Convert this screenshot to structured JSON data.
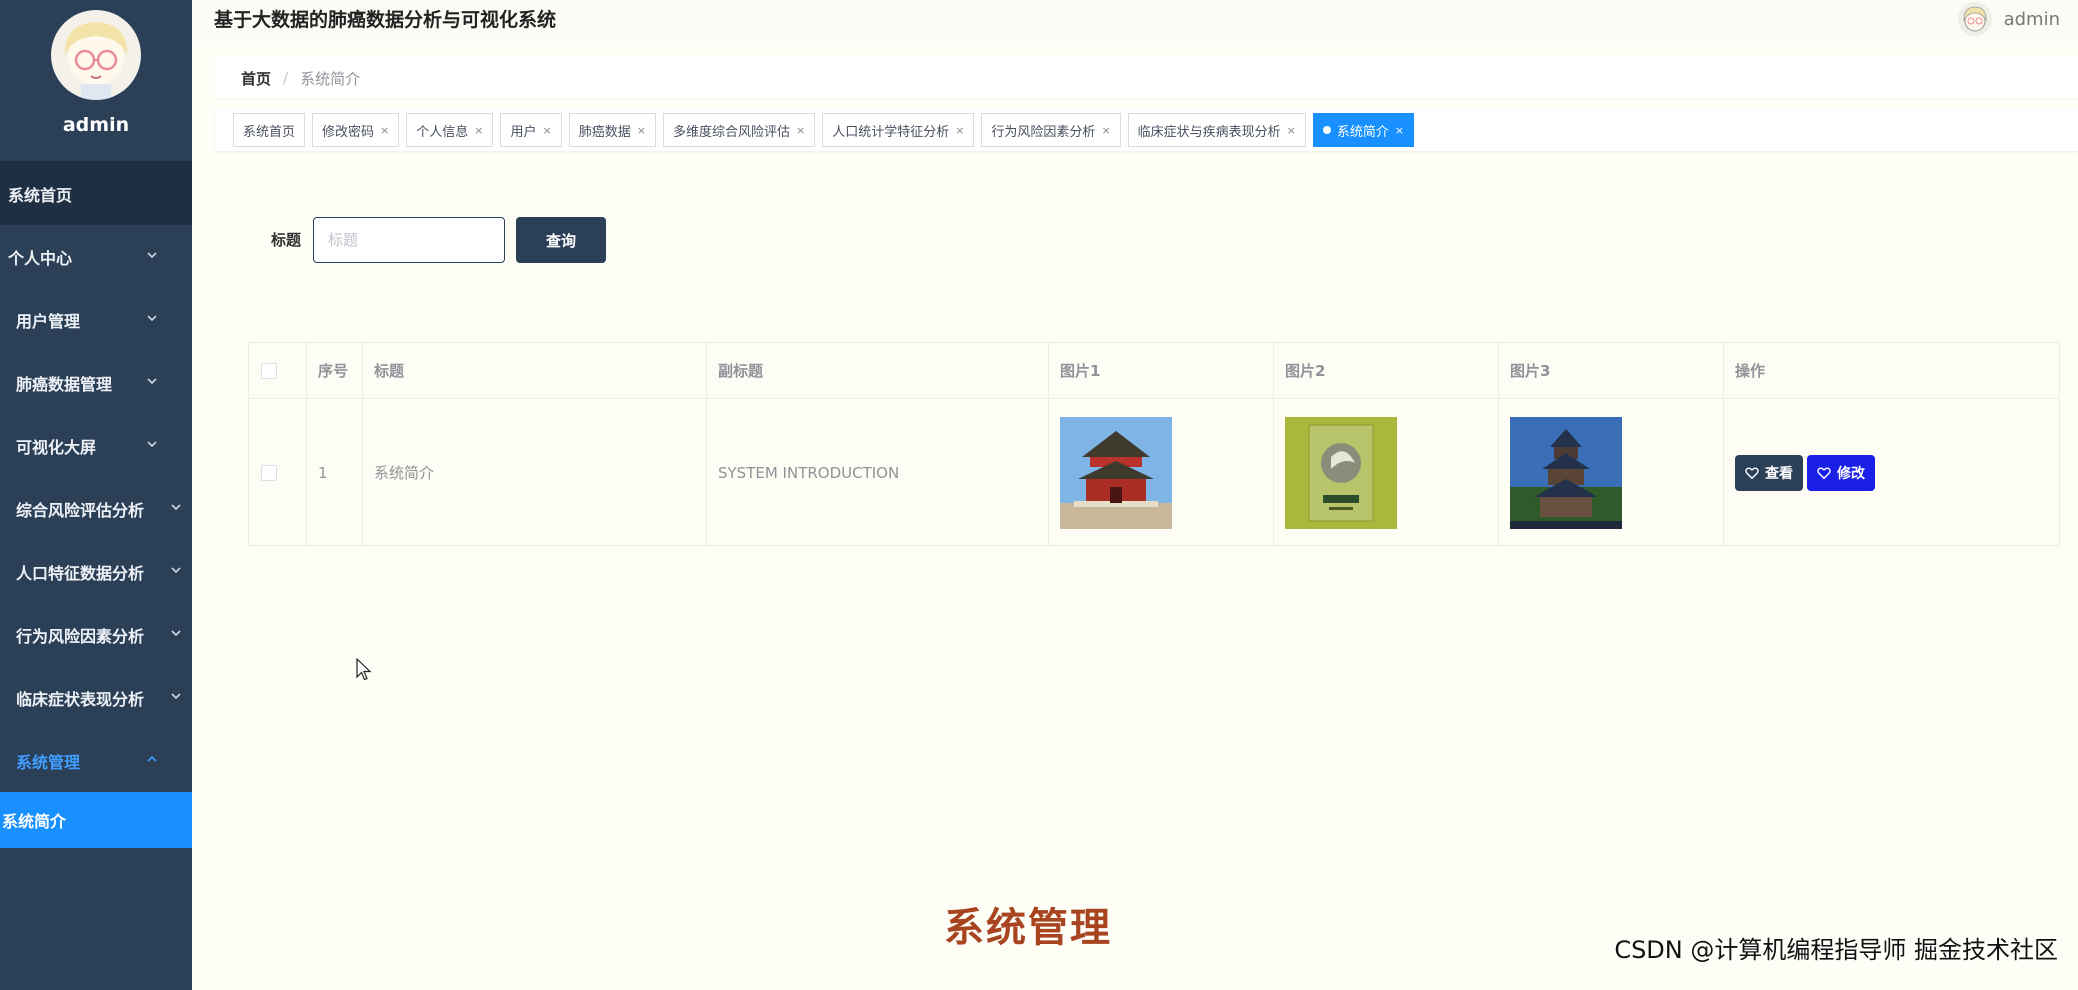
{
  "app": {
    "title": "基于大数据的肺癌数据分析与可视化系统",
    "user": "admin"
  },
  "sidebar": {
    "profile_name": "admin",
    "items": [
      {
        "label": "系统首页"
      },
      {
        "label": "个人中心"
      },
      {
        "label": "用户管理"
      },
      {
        "label": "肺癌数据管理"
      },
      {
        "label": "可视化大屏"
      },
      {
        "label": "综合风险评估分析"
      },
      {
        "label": "人口特征数据分析"
      },
      {
        "label": "行为风险因素分析"
      },
      {
        "label": "临床症状表现分析"
      },
      {
        "label": "系统管理"
      }
    ],
    "sub_item": "系统简介"
  },
  "breadcrumb": {
    "home": "首页",
    "sep": "/",
    "current": "系统简介"
  },
  "tags": [
    {
      "label": "系统首页"
    },
    {
      "label": "修改密码",
      "close": "×"
    },
    {
      "label": "个人信息",
      "close": "×"
    },
    {
      "label": "用户",
      "close": "×"
    },
    {
      "label": "肺癌数据",
      "close": "×"
    },
    {
      "label": "多维度综合风险评估",
      "close": "×"
    },
    {
      "label": "人口统计学特征分析",
      "close": "×"
    },
    {
      "label": "行为风险因素分析",
      "close": "×"
    },
    {
      "label": "临床症状与疾病表现分析",
      "close": "×"
    },
    {
      "label": "系统简介",
      "close": "×"
    }
  ],
  "search": {
    "label": "标题",
    "placeholder": "标题",
    "button": "查询"
  },
  "table": {
    "headers": [
      "序号",
      "标题",
      "副标题",
      "图片1",
      "图片2",
      "图片3",
      "操作"
    ],
    "rows": [
      {
        "index": "1",
        "title": "系统简介",
        "subtitle": "SYSTEM INTRODUCTION",
        "view": "查看",
        "edit": "修改"
      }
    ]
  },
  "overlay": {
    "caption": "系统管理",
    "watermark": "CSDN @计算机编程指导师  掘金技术社区"
  },
  "colors": {
    "sidebar": "#2b3f57",
    "active_blue": "#1890ff",
    "edit_button": "#1a1fe8",
    "caption": "#a84420"
  }
}
